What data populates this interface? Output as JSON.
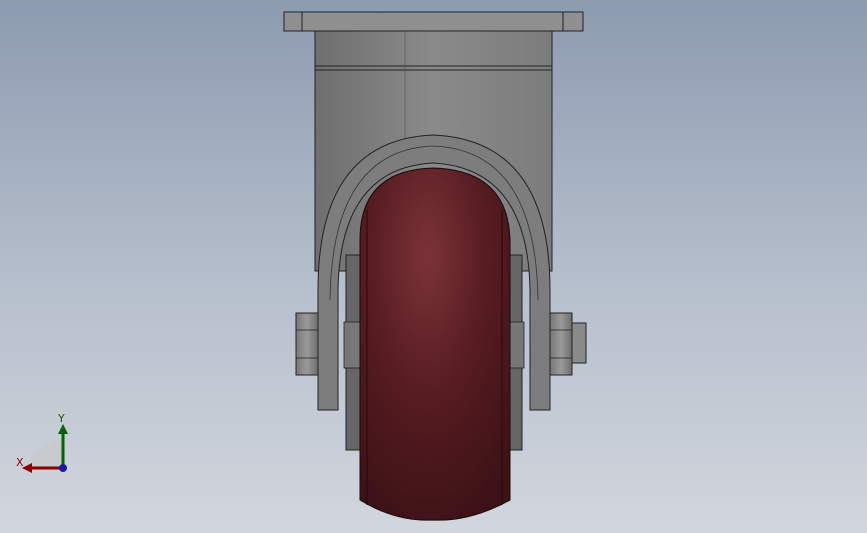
{
  "viewport": {
    "background_top": "#8d9bb0",
    "background_bottom": "#d2d6dd"
  },
  "model": {
    "plate_color": "#8c8c8c",
    "bracket_color": "#7a7a7a",
    "wheel_color": "#5a1f24",
    "wheel_highlight": "#8a3c40",
    "hub_color": "#6c6c6c"
  },
  "triad": {
    "x_label": "X",
    "y_label": "Y",
    "x_color": "#8b0000",
    "y_color": "#006400",
    "origin_color": "#1a1aa0"
  }
}
